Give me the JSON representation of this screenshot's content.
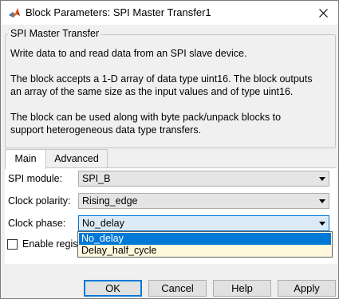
{
  "window": {
    "title": "Block Parameters: SPI Master Transfer1"
  },
  "group": {
    "title": "SPI Master Transfer",
    "paragraphs": [
      "Write data to and read data from an SPI slave device.",
      "The block accepts a 1-D array of data type uint16. The block outputs\nan array of the same size as the input values and of type uint16.",
      "The block can be used along with byte pack/unpack blocks to\nsupport heterogeneous data type transfers."
    ]
  },
  "tabs": [
    {
      "label": "Main",
      "active": true
    },
    {
      "label": "Advanced",
      "active": false
    }
  ],
  "fields": {
    "spi_module": {
      "label": "SPI module:",
      "value": "SPI_B"
    },
    "clock_polarity": {
      "label": "Clock polarity:",
      "value": "Rising_edge"
    },
    "clock_phase": {
      "label": "Clock phase:",
      "value": "No_delay"
    }
  },
  "dropdown": {
    "options": [
      "No_delay",
      "Delay_half_cycle"
    ],
    "selected": "No_delay"
  },
  "checkbox": {
    "label": "Enable regis",
    "checked": false
  },
  "buttons": {
    "ok": "OK",
    "cancel": "Cancel",
    "help": "Help",
    "apply": "Apply"
  },
  "colors": {
    "accent": "#0078d7",
    "dropdown_bg": "#fff8dc",
    "icon_matlab": "#e06a1b"
  },
  "icons": {
    "app": "matlab-logo-icon",
    "close": "close-icon",
    "combo_arrow": "chevron-down-icon"
  }
}
